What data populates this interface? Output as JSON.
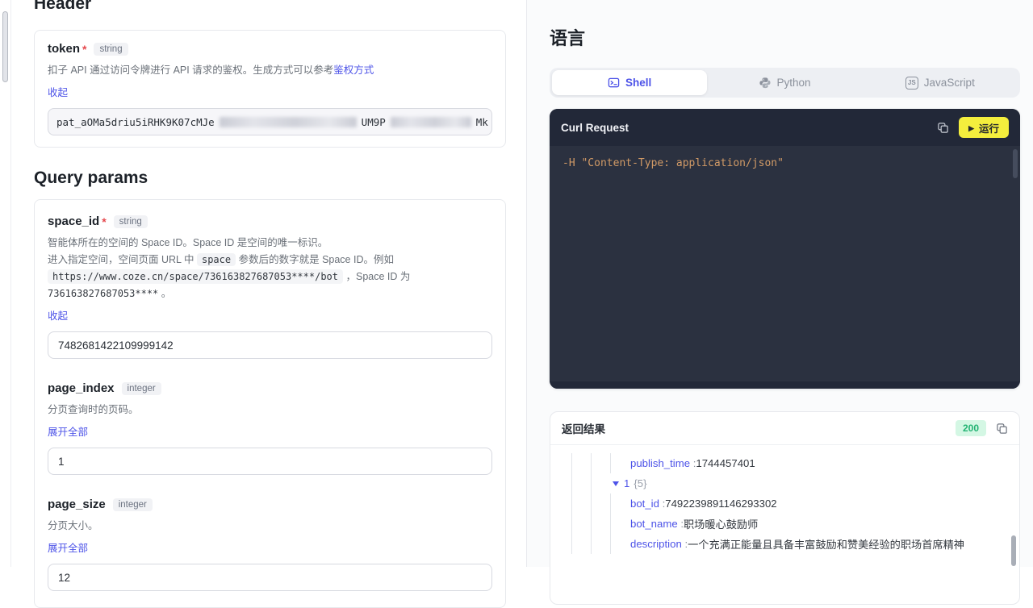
{
  "colors": {
    "accent_indigo": "#4d53e8",
    "run_button_yellow": "#f4ee3d",
    "status_green": "#23b373",
    "code_orange": "#d19a66",
    "required_red": "#e5484d"
  },
  "left": {
    "header_title": "Header",
    "token": {
      "name": "token",
      "required": "*",
      "type": "string",
      "desc": "扣子 API 通过访问令牌进行 API 请求的鉴权。生成方式可以参考",
      "desc_link": "鉴权方式",
      "collapse": "收起",
      "value_prefix": "pat_aOMa5driu5iRHK9K07cMJe",
      "value_frag1": "UM9P",
      "value_frag2": "Mk"
    },
    "query_title": "Query params",
    "space_id": {
      "name": "space_id",
      "required": "*",
      "type": "string",
      "desc1": "智能体所在的空间的 Space ID。Space ID 是空间的唯一标识。",
      "desc2_pre": "进入指定空间，空间页面 URL 中",
      "desc2_code": "space",
      "desc2_post": "参数后的数字就是 Space ID。例如",
      "url_code": "https://www.coze.cn/space/736163827687053****/bot",
      "after_url": "，Space ID 为",
      "id_value": "736163827687053****",
      "id_tail": "。",
      "collapse": "收起",
      "value": "7482681422109999142"
    },
    "page_index": {
      "name": "page_index",
      "type": "integer",
      "desc": "分页查询时的页码。",
      "expand": "展开全部",
      "value": "1"
    },
    "page_size": {
      "name": "page_size",
      "type": "integer",
      "desc": "分页大小。",
      "expand": "展开全部",
      "value": "12"
    }
  },
  "right": {
    "language_title": "语言",
    "tabs": [
      {
        "label": "Shell",
        "active": true
      },
      {
        "label": "Python",
        "active": false
      },
      {
        "label": "JavaScript",
        "active": false,
        "icon_text": "JS"
      }
    ],
    "code_panel": {
      "title": "Curl Request",
      "run_label": "运行",
      "code": "-H \"Content-Type: application/json\""
    },
    "result_panel": {
      "title": "返回结果",
      "status": "200",
      "rows": [
        {
          "key": "publish_time",
          "value": "1744457401"
        },
        {
          "key": "1",
          "badge": "{5}"
        },
        {
          "key": "bot_id",
          "value": "7492239891146293302"
        },
        {
          "key": "bot_name",
          "value": "职场暖心鼓励师"
        },
        {
          "key": "description",
          "value": "一个充满正能量且具备丰富鼓励和赞美经验的职场首席精神"
        }
      ]
    }
  }
}
